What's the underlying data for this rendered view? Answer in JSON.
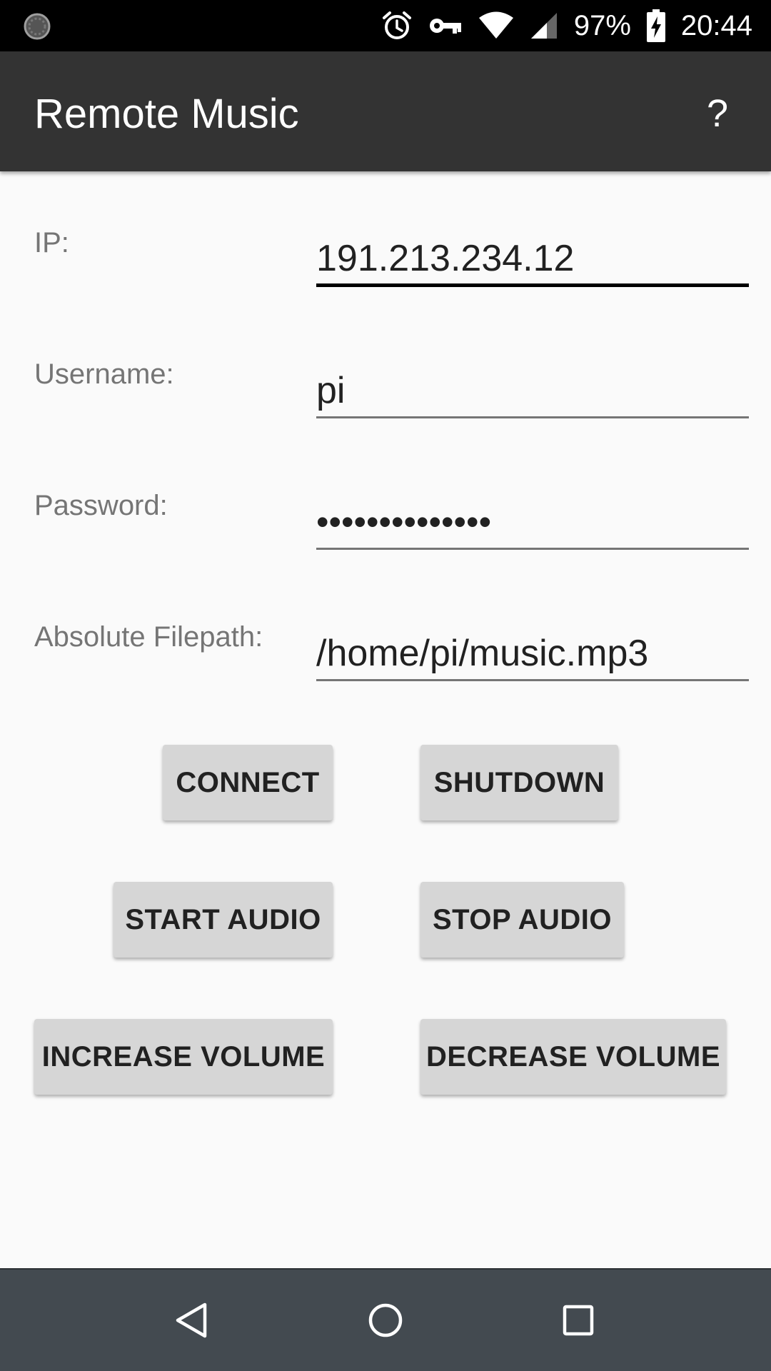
{
  "status_bar": {
    "battery_percent": "97%",
    "time": "20:44",
    "icons": [
      "loading-icon",
      "alarm-icon",
      "vpn-key-icon",
      "wifi-icon",
      "signal-icon",
      "battery-charging-icon"
    ]
  },
  "app_bar": {
    "title": "Remote Music",
    "help_label": "?"
  },
  "form": {
    "ip": {
      "label": "IP:",
      "value": "191.213.234.12",
      "focused": true
    },
    "username": {
      "label": "Username:",
      "value": "pi"
    },
    "password": {
      "label": "Password:",
      "value": "••••••••••••••"
    },
    "filepath": {
      "label": "Absolute Filepath:",
      "value": "/home/pi/music.mp3"
    }
  },
  "buttons": {
    "connect": "CONNECT",
    "shutdown": "SHUTDOWN",
    "start_audio": "START AUDIO",
    "stop_audio": "STOP AUDIO",
    "increase_volume": "INCREASE VOLUME",
    "decrease_volume": "DECREASE VOLUME"
  },
  "nav_bar": {
    "icons": [
      "back-icon",
      "home-icon",
      "recents-icon"
    ]
  },
  "colors": {
    "app_bar": "#333333",
    "background": "#fafafa",
    "button": "#d6d6d6",
    "nav_bar": "#434a50"
  }
}
